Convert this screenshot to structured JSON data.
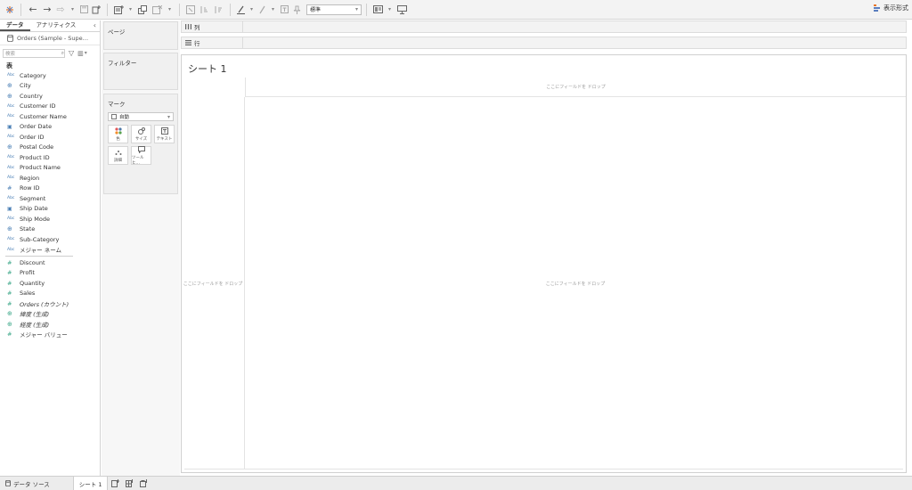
{
  "toolbar": {
    "fit": "標準",
    "show_me": "表示形式"
  },
  "data_pane": {
    "tabs": [
      "データ",
      "アナリティクス"
    ],
    "datasource": "Orders (Sample - Supe…",
    "search_placeholder": "検索",
    "section_tables": "表",
    "dimensions": [
      {
        "type": "Abc",
        "name": "Category"
      },
      {
        "type": "geo",
        "name": "City"
      },
      {
        "type": "geo",
        "name": "Country"
      },
      {
        "type": "Abc",
        "name": "Customer ID"
      },
      {
        "type": "Abc",
        "name": "Customer Name"
      },
      {
        "type": "date",
        "name": "Order Date"
      },
      {
        "type": "Abc",
        "name": "Order ID"
      },
      {
        "type": "geo",
        "name": "Postal Code"
      },
      {
        "type": "Abc",
        "name": "Product ID"
      },
      {
        "type": "Abc",
        "name": "Product Name"
      },
      {
        "type": "Abc",
        "name": "Region"
      },
      {
        "type": "num",
        "name": "Row ID"
      },
      {
        "type": "Abc",
        "name": "Segment"
      },
      {
        "type": "date",
        "name": "Ship Date"
      },
      {
        "type": "Abc",
        "name": "Ship Mode"
      },
      {
        "type": "geo",
        "name": "State"
      },
      {
        "type": "Abc",
        "name": "Sub-Category"
      },
      {
        "type": "Abc",
        "name": "メジャー ネーム"
      }
    ],
    "measures": [
      {
        "type": "num",
        "name": "Discount",
        "italic": false
      },
      {
        "type": "num",
        "name": "Profit",
        "italic": false
      },
      {
        "type": "num",
        "name": "Quantity",
        "italic": false
      },
      {
        "type": "num",
        "name": "Sales",
        "italic": false
      },
      {
        "type": "num",
        "name": "Orders (カウント)",
        "italic": true
      },
      {
        "type": "geo",
        "name": "緯度 (生成)",
        "italic": true
      },
      {
        "type": "geo",
        "name": "経度 (生成)",
        "italic": true
      },
      {
        "type": "num",
        "name": "メジャー バリュー",
        "italic": false
      }
    ]
  },
  "cards": {
    "pages": "ページ",
    "filters": "フィルター",
    "marks": "マーク",
    "marks_type": "自動",
    "mark_buttons": [
      "色",
      "サイズ",
      "テキスト",
      "詳細",
      "ツールヒ…"
    ]
  },
  "shelves": {
    "columns": "列",
    "rows": "行"
  },
  "viz": {
    "sheet_title": "シート 1",
    "drop_top": "ここにフィールドを ドロップ",
    "drop_left": "ここにフィールドを ドロップ",
    "drop_main": "ここにフィールドを ドロップ"
  },
  "bottom": {
    "datasource_tab": "データ ソース",
    "sheet_tab": "シート 1"
  }
}
